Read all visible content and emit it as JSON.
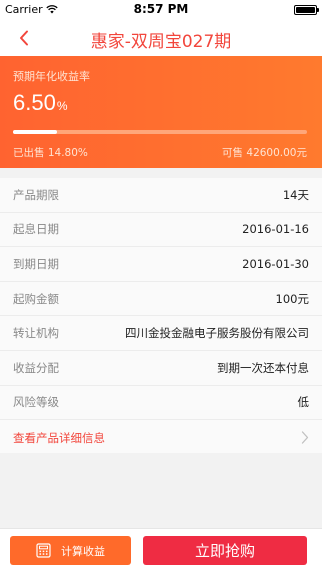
{
  "status_bar": {
    "carrier": "Carrier",
    "time": "8:57 PM"
  },
  "nav": {
    "title": "惠家-双周宝027期",
    "back_icon": "chevron-left-icon"
  },
  "hero": {
    "rate_label": "预期年化收益率",
    "rate_value": "6.50",
    "rate_unit": "%",
    "sold_text": "已出售 14.80%",
    "sold_fraction": 0.148,
    "available_text": "可售 42600.00元"
  },
  "info_rows": [
    {
      "label": "产品期限",
      "value": "14天"
    },
    {
      "label": "起息日期",
      "value": "2016-01-16"
    },
    {
      "label": "到期日期",
      "value": "2016-01-30"
    },
    {
      "label": "起购金额",
      "value": "100元"
    },
    {
      "label": "转让机构",
      "value": "四川金投金融电子服务股份有限公司"
    },
    {
      "label": "收益分配",
      "value": "到期一次还本付息"
    },
    {
      "label": "风险等级",
      "value": "低"
    }
  ],
  "detail_link": {
    "label": "查看产品详细信息",
    "icon": "chevron-right-icon"
  },
  "bottom_bar": {
    "calc_label": "计算收益",
    "calc_icon": "calculator-icon",
    "buy_label": "立即抢购"
  },
  "colors": {
    "accent_orange": "#ff6a2a",
    "title_red": "#f2463c",
    "buy_red": "#ef2c43"
  }
}
